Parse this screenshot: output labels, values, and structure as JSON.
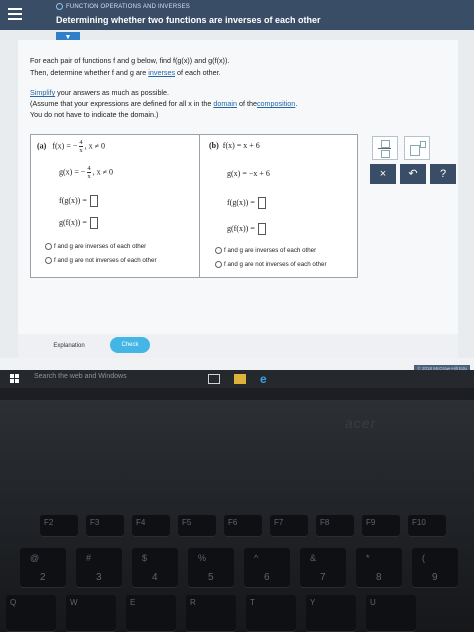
{
  "header": {
    "breadcrumb": "FUNCTION OPERATIONS AND INVERSES",
    "title": "Determining whether two functions are inverses of each other"
  },
  "instructions": {
    "line1": "For each pair of functions f and g below, find f(g(x)) and g(f(x)).",
    "line2_prefix": "Then, determine whether f and g are",
    "line2_link": "inverses",
    "line2_suffix": "of each other.",
    "simplify_link": "Simplify",
    "simplify_text": "your answers as much as possible.",
    "assume_prefix": "(Assume that your expressions are defined for all x in the",
    "assume_link1": "domain",
    "assume_mid": "of the",
    "assume_link2": "composition",
    "assume_end": ".",
    "no_domain": "You do not have to indicate the domain.)"
  },
  "part_a": {
    "label": "(a)",
    "f_prefix": "f(x) = −",
    "f_num": "4",
    "f_den": "x",
    "f_cond": ", x ≠ 0",
    "g_prefix": "g(x) = −",
    "g_num": "4",
    "g_den": "x",
    "g_cond": ", x ≠ 0",
    "fog": "f(g(x)) =",
    "gof": "g(f(x)) =",
    "option_inverse": "f and g are inverses of each other",
    "option_not_inverse": "f and g are not inverses of each other"
  },
  "part_b": {
    "label": "(b)",
    "f": "f(x) = x + 6",
    "g": "g(x) = −x + 6",
    "fog": "f(g(x)) =",
    "gof": "g(f(x)) =",
    "option_inverse": "f and g are inverses of each other",
    "option_not_inverse": "f and g are not inverses of each other"
  },
  "tools": {
    "clear": "×",
    "undo": "↶",
    "help": "?"
  },
  "footer": {
    "explanation": "Explanation",
    "check": "Check",
    "copyright": "© 2018 McGraw-Hill Edu"
  },
  "taskbar": {
    "search_placeholder": "Search the web and Windows"
  },
  "laptop": {
    "brand": "acer",
    "fn_keys": [
      "F2",
      "F3",
      "F4",
      "F5",
      "F6",
      "F7",
      "F8",
      "F9",
      "F10"
    ],
    "number_keys": [
      "2",
      "3",
      "4",
      "5",
      "6",
      "7",
      "8",
      "9"
    ],
    "symbol_keys": [
      "@",
      "#",
      "$",
      "%",
      "^",
      "&",
      "*",
      "("
    ],
    "letter_keys": [
      "Q",
      "W",
      "E",
      "R",
      "T",
      "Y",
      "U"
    ]
  }
}
